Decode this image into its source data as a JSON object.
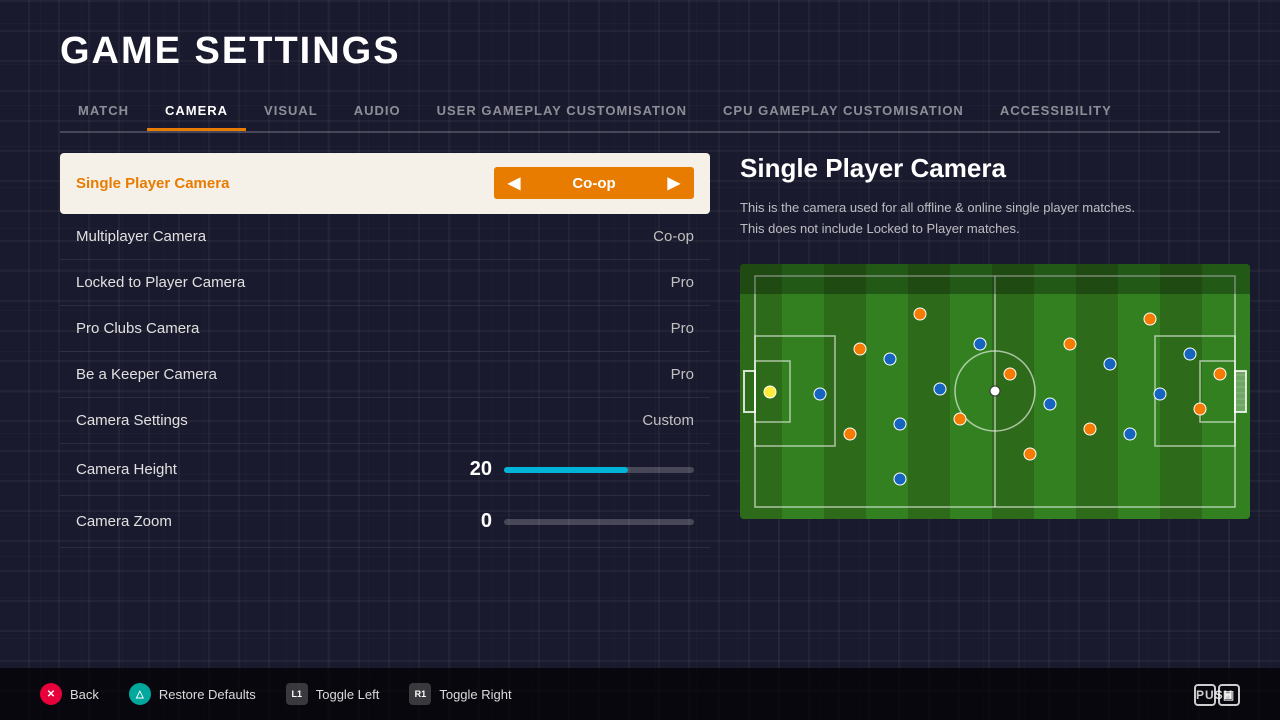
{
  "page": {
    "title": "GAME SETTINGS"
  },
  "tabs": [
    {
      "id": "match",
      "label": "MATCH",
      "active": false
    },
    {
      "id": "camera",
      "label": "CAMERA",
      "active": true
    },
    {
      "id": "visual",
      "label": "VISUAL",
      "active": false
    },
    {
      "id": "audio",
      "label": "AUDIO",
      "active": false
    },
    {
      "id": "user-gameplay",
      "label": "USER GAMEPLAY CUSTOMISATION",
      "active": false
    },
    {
      "id": "cpu-gameplay",
      "label": "CPU GAMEPLAY CUSTOMISATION",
      "active": false
    },
    {
      "id": "accessibility",
      "label": "ACCESSIBILITY",
      "active": false
    }
  ],
  "settings": [
    {
      "id": "single-player-camera",
      "name": "Single Player Camera",
      "value": "Co-op",
      "type": "selector",
      "active": true
    },
    {
      "id": "multiplayer-camera",
      "name": "Multiplayer Camera",
      "value": "Co-op",
      "type": "value"
    },
    {
      "id": "locked-to-player-camera",
      "name": "Locked to Player Camera",
      "value": "Pro",
      "type": "value"
    },
    {
      "id": "pro-clubs-camera",
      "name": "Pro Clubs Camera",
      "value": "Pro",
      "type": "value"
    },
    {
      "id": "be-a-keeper-camera",
      "name": "Be a Keeper Camera",
      "value": "Pro",
      "type": "value"
    },
    {
      "id": "camera-settings",
      "name": "Camera Settings",
      "value": "Custom",
      "type": "value"
    },
    {
      "id": "camera-height",
      "name": "Camera Height",
      "value": "20",
      "type": "slider-blue"
    },
    {
      "id": "camera-zoom",
      "name": "Camera Zoom",
      "value": "0",
      "type": "slider-gray"
    }
  ],
  "info": {
    "title": "Single Player Camera",
    "description": "This is the camera used for all offline & online single player matches.\nThis does not include Locked to Player matches."
  },
  "bottom_bar": {
    "back_label": "Back",
    "restore_label": "Restore Defaults",
    "toggle_left_label": "Toggle Left",
    "toggle_right_label": "Toggle Right"
  },
  "push_logo": "PUSH"
}
